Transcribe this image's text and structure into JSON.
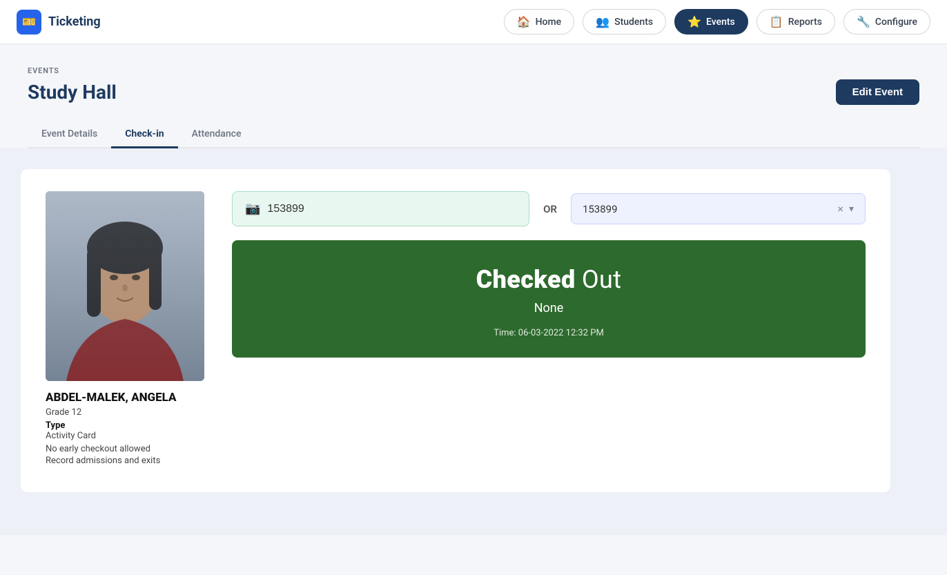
{
  "brand": {
    "icon": "🎫",
    "name": "Ticketing"
  },
  "nav": {
    "items": [
      {
        "id": "home",
        "label": "Home",
        "icon": "🏠",
        "active": false
      },
      {
        "id": "students",
        "label": "Students",
        "icon": "👥",
        "active": false
      },
      {
        "id": "events",
        "label": "Events",
        "icon": "⭐",
        "active": true
      },
      {
        "id": "reports",
        "label": "Reports",
        "icon": "📋",
        "active": false
      },
      {
        "id": "configure",
        "label": "Configure",
        "icon": "🔧",
        "active": false
      }
    ]
  },
  "breadcrumb": "EVENTS",
  "page_title": "Study Hall",
  "edit_button_label": "Edit Event",
  "tabs": [
    {
      "id": "event-details",
      "label": "Event Details",
      "active": false
    },
    {
      "id": "check-in",
      "label": "Check-in",
      "active": true
    },
    {
      "id": "attendance",
      "label": "Attendance",
      "active": false
    }
  ],
  "checkin": {
    "scan_value": "153899",
    "scan_placeholder": "153899",
    "or_label": "OR",
    "select_value": "153899",
    "status": {
      "title_bold": "Checked",
      "title_light": "Out",
      "subtitle": "None",
      "time_label": "Time:",
      "time_value": "06-03-2022 12:32 PM"
    }
  },
  "student": {
    "name": "ABDEL-MALEK, ANGELA",
    "grade": "Grade 12",
    "type_label": "Type",
    "type_value": "Activity Card",
    "note1": "No early checkout allowed",
    "note2": "Record admissions and exits"
  },
  "colors": {
    "status_green": "#2d6a2d",
    "active_nav": "#1e3a5f"
  }
}
